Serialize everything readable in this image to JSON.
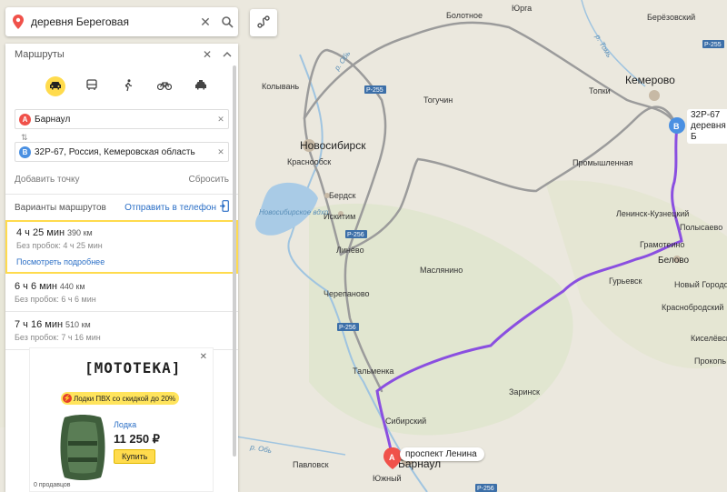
{
  "search": {
    "query": "деревня Береговая"
  },
  "panel": {
    "title": "Маршруты",
    "modes": [
      {
        "name": "car",
        "active": true
      },
      {
        "name": "transit",
        "active": false
      },
      {
        "name": "walk",
        "active": false
      },
      {
        "name": "bike",
        "active": false
      },
      {
        "name": "taxi",
        "active": false
      }
    ],
    "waypoint_a": {
      "letter": "A",
      "value": "Барнаул",
      "color": "#f0514a"
    },
    "waypoint_b": {
      "letter": "B",
      "value": "32Р-67, Россия, Кемеровская область",
      "color": "#4a90e2"
    },
    "add_point": "Добавить точку",
    "reset": "Сбросить",
    "variants_label": "Варианты маршрутов",
    "send_to_phone": "Отправить в телефон",
    "routes": [
      {
        "time": "4 ч 25 мин",
        "dist": "390 км",
        "no_traffic": "Без пробок: 4 ч 25 мин",
        "more": "Посмотреть подробнее"
      },
      {
        "time": "6 ч 6 мин",
        "dist": "440 км",
        "no_traffic": "Без пробок: 6 ч 6 мин"
      },
      {
        "time": "7 ч 16 мин",
        "dist": "510 км",
        "no_traffic": "Без пробок: 7 ч 16 мин"
      }
    ],
    "ad": {
      "brand": "МОТОТЕКА",
      "promo": "Лодки ПВХ со скидкой до 20%",
      "product": "Лодка",
      "price": "11 250 ₽",
      "buy": "Купить",
      "sold": "0 продавцов"
    }
  },
  "map": {
    "pin_a_label": "проспект Ленина",
    "pin_a_letter": "A",
    "pin_b_letter": "B",
    "pin_b_line1": "32Р-67",
    "pin_b_line2": "деревня Б",
    "colors": {
      "route_active": "#8a4fe0",
      "route_alt": "#9b9b9b",
      "water": "#a9cbe6"
    },
    "cities": {
      "yurga": "Юрга",
      "bolotnoe": "Болотное",
      "beryozovsky": "Берёзовский",
      "kemerovo": "Кемерово",
      "kolyvan": "Колывань",
      "toguchin": "Тогучин",
      "topki": "Топки",
      "novosibirsk": "Новосибирск",
      "krasnoobsk": "Краснообск",
      "promyshlennaya": "Промышленная",
      "berdsk": "Бердск",
      "iskitim": "Искитим",
      "leninsk": "Ленинск-Кузнецкий",
      "polysaevo": "Полысаево",
      "linevo": "Линёво",
      "gramoteino": "Грамотеино",
      "belovo": "Белово",
      "maslyanino": "Маслянино",
      "guryevsk": "Гурьевск",
      "novy_gorodok": "Новый Городок",
      "cherepanovo": "Черепаново",
      "krasnobrodsky": "Краснобродский",
      "kiselyovsk": "Киселёвск",
      "prokopyevsk": "Прокопь",
      "talmenka": "Тальменка",
      "zarinsk": "Заринск",
      "sibirsky": "Сибирский",
      "pavlovsk": "Павловск",
      "yuzhny": "Южный",
      "barnaul": "Барнаул",
      "reservoir": "Новосибирское вдхр."
    },
    "rivers": {
      "ob1": "р. Обь",
      "ob2": "р. Обь",
      "tom": "р. Томь"
    },
    "roads": {
      "r255a": "Р-255",
      "r255b": "Р-255",
      "r256a": "Р-256",
      "r256b": "Р-256",
      "r256c": "Р-256"
    }
  }
}
